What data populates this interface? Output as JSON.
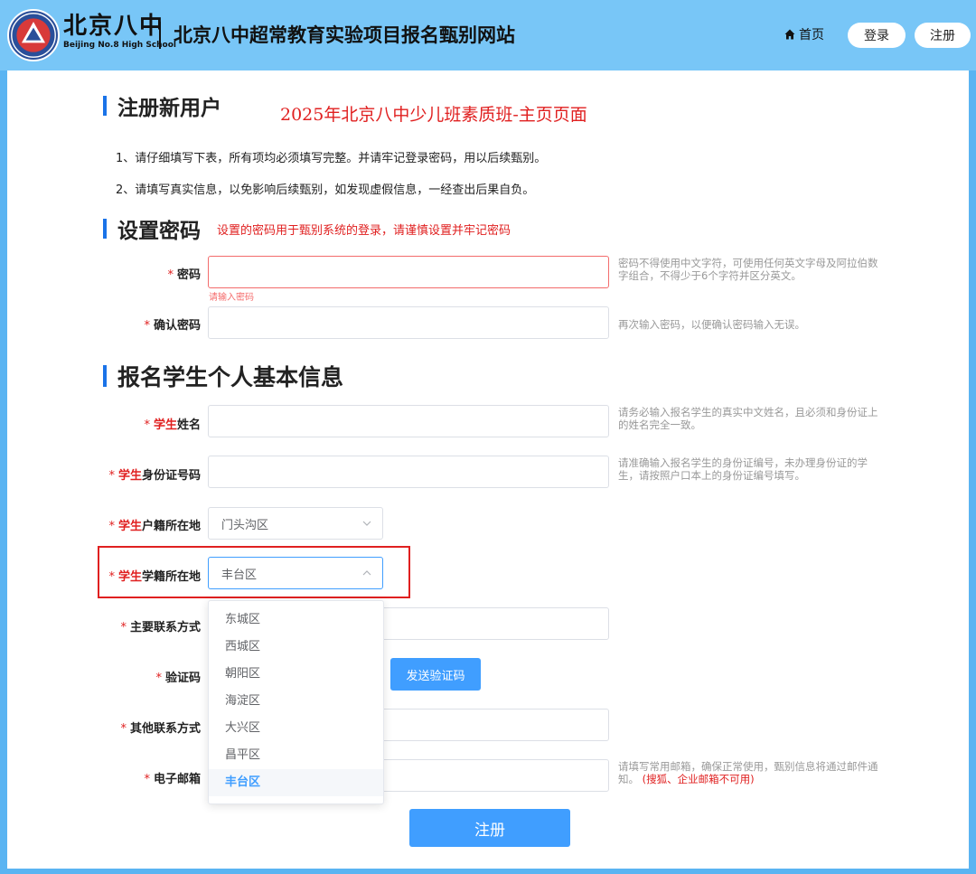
{
  "header": {
    "logo_cn": "北京八中",
    "logo_en": "Beijing No.8 High School",
    "site_title": "北京八中超常教育实验项目报名甄别网站",
    "home_label": "首页",
    "login_label": "登录",
    "register_label": "注册"
  },
  "register": {
    "title": "注册新用户",
    "overlay_title": "2025年北京八中少儿班素质班-主页页面",
    "instructions": [
      "1、请仔细填写下表，所有项均必须填写完整。并请牢记登录密码，用以后续甄别。",
      "2、请填写真实信息，以免影响后续甄别，如发现虚假信息，一经查出后果自负。"
    ]
  },
  "password_section": {
    "title": "设置密码",
    "note": "设置的密码用于甄别系统的登录，请谨慎设置并牢记密码",
    "password": {
      "required_mark": "*",
      "label": "密码",
      "value": "",
      "error": "请输入密码",
      "hint": "密码不得使用中文字符，可使用任何英文字母及阿拉伯数字组合，不得少于6个字符并区分英文。"
    },
    "confirm": {
      "required_mark": "*",
      "label": "确认密码",
      "value": "",
      "hint": "再次输入密码，以便确认密码输入无误。"
    }
  },
  "student_section": {
    "title": "报名学生个人基本信息",
    "student_word": "学生",
    "name": {
      "required_mark": "*",
      "label_rest": "姓名",
      "value": "",
      "hint": "请务必输入报名学生的真实中文姓名，且必须和身份证上的姓名完全一致。"
    },
    "id_number": {
      "required_mark": "*",
      "label_rest": "身份证号码",
      "value": "",
      "hint": "请准确输入报名学生的身份证编号，未办理身份证的学生，请按照户口本上的身份证编号填写。"
    },
    "hukou": {
      "required_mark": "*",
      "label_rest": "户籍所在地",
      "selected": "门头沟区"
    },
    "school_reg": {
      "required_mark": "*",
      "label_rest": "学籍所在地",
      "selected": "丰台区"
    },
    "main_contact": {
      "required_mark": "*",
      "label": "主要联系方式",
      "value": ""
    },
    "verify_code": {
      "required_mark": "*",
      "label": "验证码",
      "value": "",
      "send_button": "发送验证码"
    },
    "other_contact": {
      "required_mark": "*",
      "label": "其他联系方式",
      "value": ""
    },
    "email": {
      "required_mark": "*",
      "label": "电子邮箱",
      "value": "",
      "hint": "请填写常用邮箱，确保正常使用，甄别信息将通过邮件通知。",
      "hint_warn": "(搜狐、企业邮箱不可用)"
    }
  },
  "dropdown": {
    "options": [
      "东城区",
      "西城区",
      "朝阳区",
      "海淀区",
      "大兴区",
      "昌平区",
      "丰台区"
    ],
    "selected_index": 6
  },
  "submit_label": "注册",
  "colors": {
    "header_bg": "#78c6f7",
    "accent": "#409eff",
    "required": "#e02020"
  }
}
